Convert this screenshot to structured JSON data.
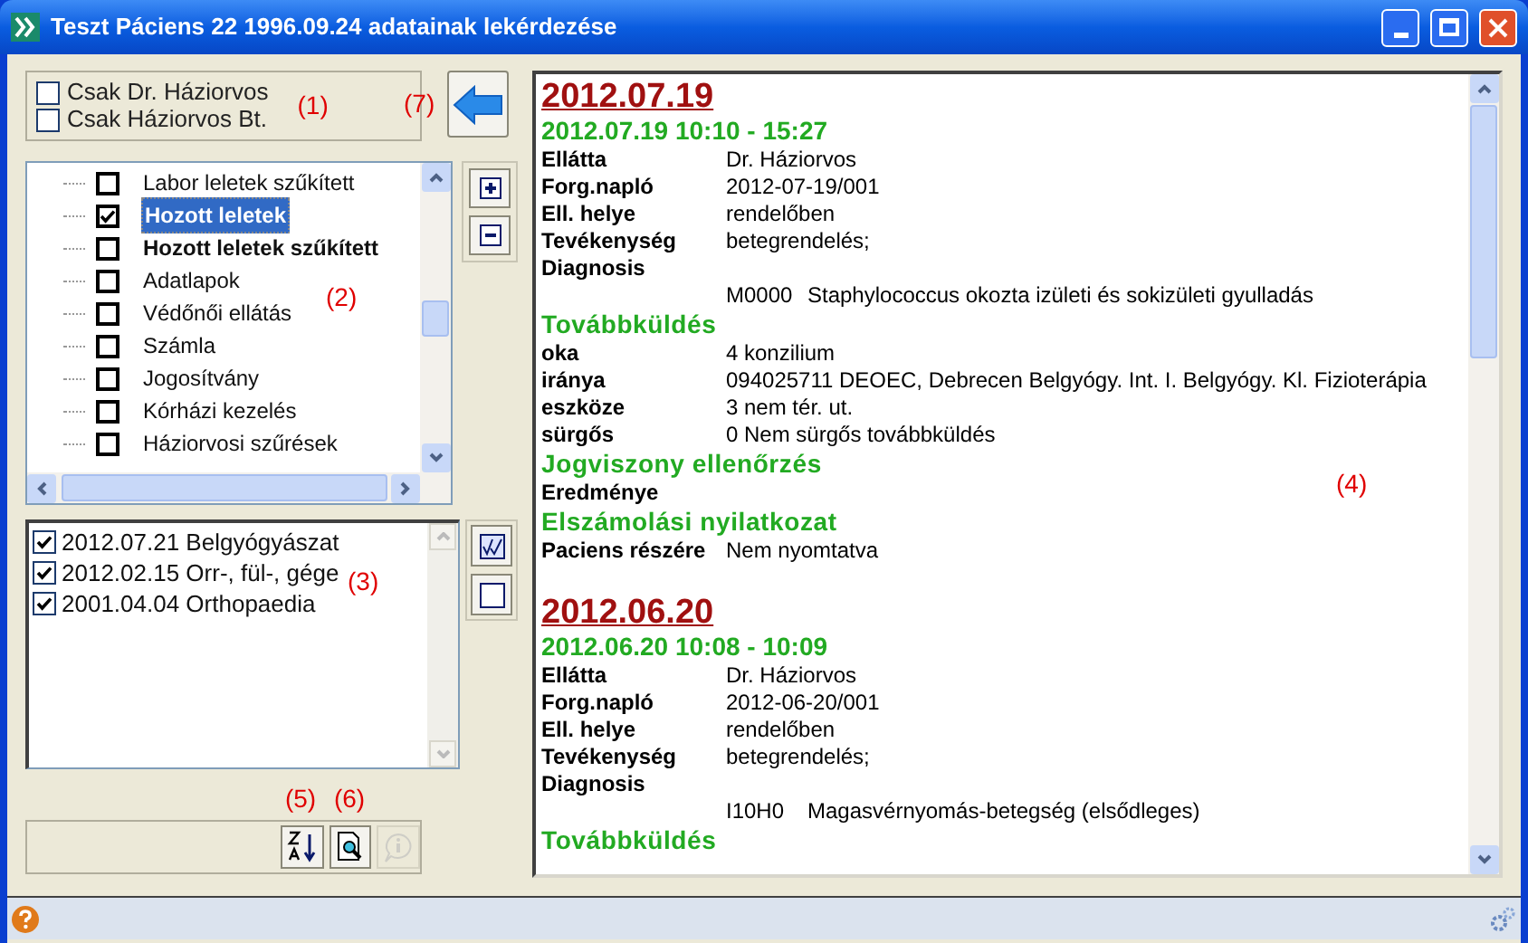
{
  "window": {
    "title": "Teszt Páciens 22 1996.09.24 adatainak lekérdezése"
  },
  "filters": {
    "annotation": "(1)",
    "items": [
      {
        "label": "Csak Dr. Háziorvos",
        "checked": false
      },
      {
        "label": "Csak Háziorvos Bt.",
        "checked": false
      }
    ]
  },
  "back_button": {
    "annotation": "(7)"
  },
  "tree": {
    "annotation": "(2)",
    "items": [
      {
        "label": "Labor leletek szűkített",
        "checked": false,
        "selected": false,
        "bold": false
      },
      {
        "label": "Hozott leletek",
        "checked": true,
        "selected": true,
        "bold": true
      },
      {
        "label": "Hozott leletek szűkített",
        "checked": false,
        "selected": false,
        "bold": true
      },
      {
        "label": "Adatlapok",
        "checked": false,
        "selected": false,
        "bold": false
      },
      {
        "label": "Védőnői ellátás",
        "checked": false,
        "selected": false,
        "bold": false
      },
      {
        "label": "Számla",
        "checked": false,
        "selected": false,
        "bold": false
      },
      {
        "label": "Jogosítvány",
        "checked": false,
        "selected": false,
        "bold": false
      },
      {
        "label": "Kórházi kezelés",
        "checked": false,
        "selected": false,
        "bold": false
      },
      {
        "label": "Háziorvosi szűrések",
        "checked": false,
        "selected": false,
        "bold": false
      }
    ]
  },
  "episodes": {
    "annotation": "(3)",
    "items": [
      {
        "label": "2012.07.21 Belgyógyászat",
        "checked": true
      },
      {
        "label": "2012.02.15 Orr-, fül-, gége",
        "checked": true
      },
      {
        "label": "2001.04.04 Orthopaedia",
        "checked": true
      }
    ]
  },
  "toolbar": {
    "buttons": [
      {
        "kind": "sort",
        "annotation": "(5)",
        "disabled": false
      },
      {
        "kind": "preview",
        "annotation": "(6)",
        "disabled": false
      },
      {
        "kind": "info",
        "disabled": true
      }
    ]
  },
  "document": {
    "annotation": "(4)",
    "blocks": [
      {
        "kind": "date",
        "text": "2012.07.19"
      },
      {
        "kind": "heading",
        "text": "2012.07.19 10:10 - 15:27"
      },
      {
        "kind": "field",
        "label": "Ellátta",
        "value": "Dr. Háziorvos"
      },
      {
        "kind": "field",
        "label": "Forg.napló",
        "value": "2012-07-19/001"
      },
      {
        "kind": "field",
        "label": "Ell. helye",
        "value": "rendelőben"
      },
      {
        "kind": "field",
        "label": "Tevékenység",
        "value": "betegrendelés;"
      },
      {
        "kind": "field",
        "label": "Diagnosis"
      },
      {
        "kind": "diagnosis",
        "code": "M0000",
        "text": "Staphylococcus okozta izületi és sokizületi gyulladás"
      },
      {
        "kind": "section",
        "text": "Továbbküldés"
      },
      {
        "kind": "field",
        "label": "oka",
        "value": "4 konzilium"
      },
      {
        "kind": "field",
        "label": "iránya",
        "value": "094025711 DEOEC, Debrecen Belgyógy. Int. I. Belgyógy. Kl. Fizioterápia"
      },
      {
        "kind": "field",
        "label": "eszköze",
        "value": "3 nem tér. ut."
      },
      {
        "kind": "field",
        "label": "sürgős",
        "value": "0 Nem sürgős továbbküldés"
      },
      {
        "kind": "section",
        "text": "Jogviszony ellenőrzés"
      },
      {
        "kind": "field",
        "label": "Eredménye"
      },
      {
        "kind": "section",
        "text": "Elszámolási nyilatkozat"
      },
      {
        "kind": "field",
        "label": "Paciens részére",
        "value": "Nem nyomtatva"
      },
      {
        "kind": "date",
        "text": "2012.06.20"
      },
      {
        "kind": "heading",
        "text": "2012.06.20 10:08 - 10:09"
      },
      {
        "kind": "field",
        "label": "Ellátta",
        "value": "Dr. Háziorvos"
      },
      {
        "kind": "field",
        "label": "Forg.napló",
        "value": "2012-06-20/001"
      },
      {
        "kind": "field",
        "label": "Ell. helye",
        "value": "rendelőben"
      },
      {
        "kind": "field",
        "label": "Tevékenység",
        "value": "betegrendelés;"
      },
      {
        "kind": "field",
        "label": "Diagnosis"
      },
      {
        "kind": "diagnosis",
        "code": "I10H0",
        "text": "Magasvérnyomás-betegség (elsődleges)"
      },
      {
        "kind": "section",
        "text": "Továbbküldés"
      }
    ]
  }
}
